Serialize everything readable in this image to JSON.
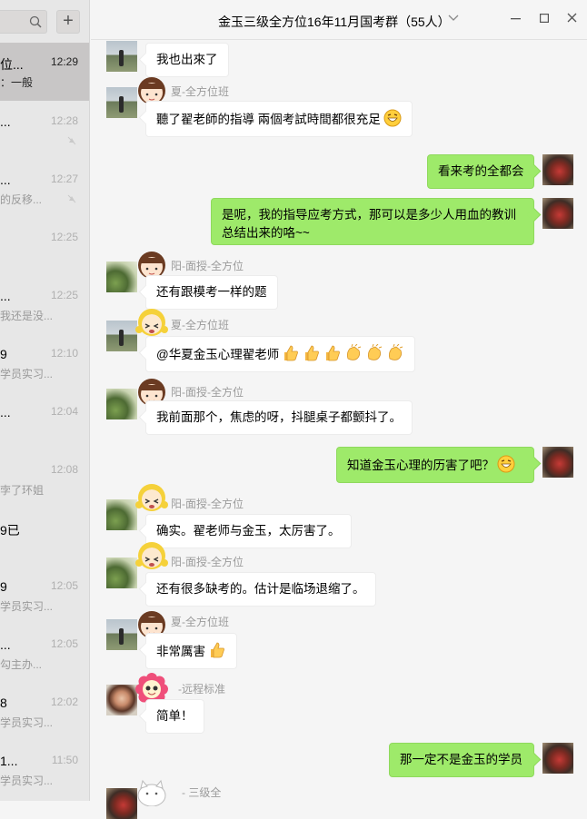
{
  "window": {
    "title": "金玉三级全方位16年11月国考群（55人）"
  },
  "sidebar": {
    "add_label": "+",
    "sessions": [
      {
        "name": "位...",
        "preview": "：一般",
        "time": "12:29",
        "active": true
      },
      {
        "name": "...",
        "preview": "",
        "time": "12:28"
      },
      {
        "name": "...",
        "preview": "的反移...",
        "time": "12:27"
      },
      {
        "name": "",
        "preview": "",
        "time": "12:25"
      },
      {
        "name": "...",
        "preview": "我还是没...",
        "time": "12:25"
      },
      {
        "name": "9",
        "preview": "学员实习...",
        "time": "12:10"
      },
      {
        "name": "...",
        "preview": "",
        "time": "12:04"
      },
      {
        "name": "",
        "preview": "孛了环姐",
        "time": "12:08"
      },
      {
        "name": "9已",
        "preview": "",
        "time": ""
      },
      {
        "name": "9",
        "preview": "学员实习...",
        "time": "12:05"
      },
      {
        "name": "...",
        "preview": "勾主办...",
        "time": "12:05"
      },
      {
        "name": "8",
        "preview": "学员实习...",
        "time": "12:02"
      },
      {
        "name": "1...",
        "preview": "学员实习...",
        "time": "11:50"
      }
    ]
  },
  "messages": [
    {
      "side": "left",
      "sender": "",
      "text": "我也出來了",
      "emoji": []
    },
    {
      "side": "left",
      "sender": "夏-全方位班",
      "text": "聽了翟老師的指導 兩個考試時間都很充足",
      "emoji": [
        "grin"
      ]
    },
    {
      "side": "right",
      "sender": "",
      "text": "看来考的全都会",
      "emoji": []
    },
    {
      "side": "right",
      "sender": "",
      "text": "是呢，我的指导应考方式，那可以是多少人用血的教训",
      "text2": "总结出来的咯~~",
      "emoji": []
    },
    {
      "side": "left",
      "sender": "阳-面授-全方位",
      "text": "还有跟模考一样的题",
      "emoji": []
    },
    {
      "side": "left",
      "sender": "夏-全方位班",
      "text": "@华夏金玉心理翟老师",
      "emoji": [
        "thumb",
        "thumb",
        "thumb",
        "clap",
        "clap",
        "clap"
      ]
    },
    {
      "side": "left",
      "sender": "阳-面授-全方位",
      "text": "我前面那个，焦虑的呀，抖腿桌子都颤抖了。",
      "emoji": []
    },
    {
      "side": "right",
      "sender": "",
      "text": "知道金玉心理的历害了吧？",
      "emoji": [
        "grin"
      ]
    },
    {
      "side": "left",
      "sender": "阳-面授-全方位",
      "text": "确实。翟老师与金玉，太厉害了。",
      "emoji": []
    },
    {
      "side": "left",
      "sender": "阳-面授-全方位",
      "text": "还有很多缺考的。估计是临场退缩了。",
      "emoji": []
    },
    {
      "side": "left",
      "sender": "夏-全方位班",
      "text": "非常厲害",
      "emoji": [
        "thumb"
      ]
    },
    {
      "side": "left",
      "sender": "-远程标准",
      "text": "简单！",
      "emoji": []
    },
    {
      "side": "right",
      "sender": "",
      "text": "那一定不是金玉的学员",
      "emoji": []
    },
    {
      "side": "left",
      "sender": "- 三级全",
      "text": "",
      "emoji": []
    }
  ],
  "colors": {
    "bubble_self": "#9eea6a",
    "bubble_other": "#ffffff",
    "sidebar_bg": "#e7e7e7",
    "active_session": "#c8c6c6"
  }
}
